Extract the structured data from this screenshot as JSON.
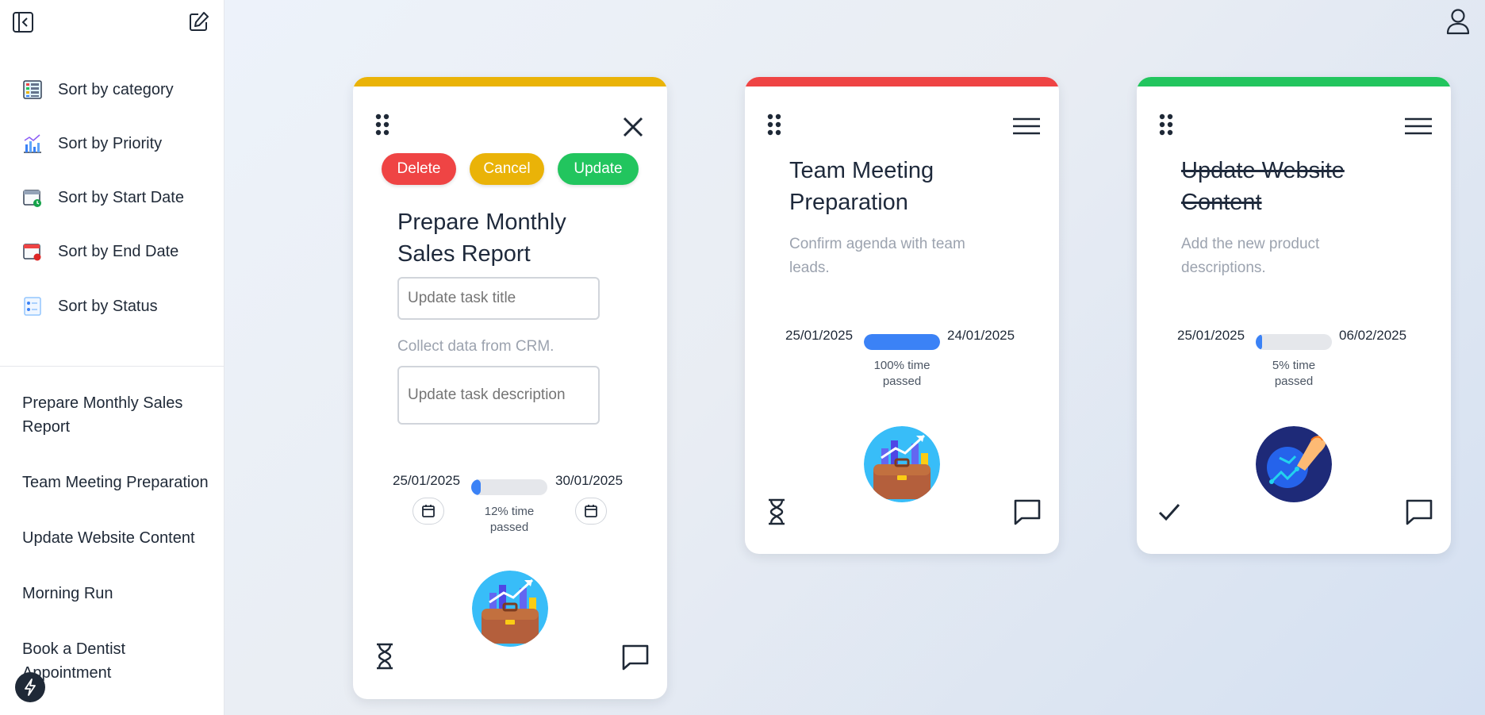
{
  "sidebar": {
    "sort_items": [
      {
        "label": "Sort by category",
        "icon": "category-sort-icon"
      },
      {
        "label": "Sort by Priority",
        "icon": "priority-sort-icon"
      },
      {
        "label": "Sort by Start Date",
        "icon": "start-date-sort-icon"
      },
      {
        "label": "Sort by End Date",
        "icon": "end-date-sort-icon"
      },
      {
        "label": "Sort by Status",
        "icon": "status-sort-icon"
      }
    ],
    "tasks": [
      "Prepare Monthly Sales Report",
      "Team Meeting Preparation",
      "Update Website Content",
      "Morning Run",
      "Book a Dentist Appointment"
    ]
  },
  "cards": [
    {
      "accent": "#eab308",
      "mode": "editing",
      "buttons": {
        "delete": "Delete",
        "cancel": "Cancel",
        "update": "Update"
      },
      "button_colors": {
        "delete": "#ef4444",
        "cancel": "#eab308",
        "update": "#22c55e"
      },
      "title": "Prepare Monthly Sales Report",
      "title_placeholder": "Update task title",
      "description": "Collect data from CRM.",
      "description_placeholder": "Update task description",
      "start_date": "25/01/2025",
      "end_date": "30/01/2025",
      "progress_percent": 12,
      "progress_label": "12% time passed",
      "status_icon": "hourglass-icon",
      "illustration": "briefcase-chart-illustration"
    },
    {
      "accent": "#ef4444",
      "mode": "view",
      "title": "Team Meeting Preparation",
      "description": "Confirm agenda with team leads.",
      "start_date": "25/01/2025",
      "end_date": "24/01/2025",
      "progress_percent": 100,
      "progress_label": "100% time passed",
      "status_icon": "hourglass-icon",
      "illustration": "briefcase-chart-illustration"
    },
    {
      "accent": "#22c55e",
      "mode": "view",
      "completed": true,
      "title": "Update Website Content",
      "description": "Add the new product descriptions.",
      "start_date": "25/01/2025",
      "end_date": "06/02/2025",
      "progress_percent": 5,
      "progress_label": "5% time passed",
      "status_icon": "checkmark-icon",
      "illustration": "hand-circuit-illustration"
    }
  ]
}
